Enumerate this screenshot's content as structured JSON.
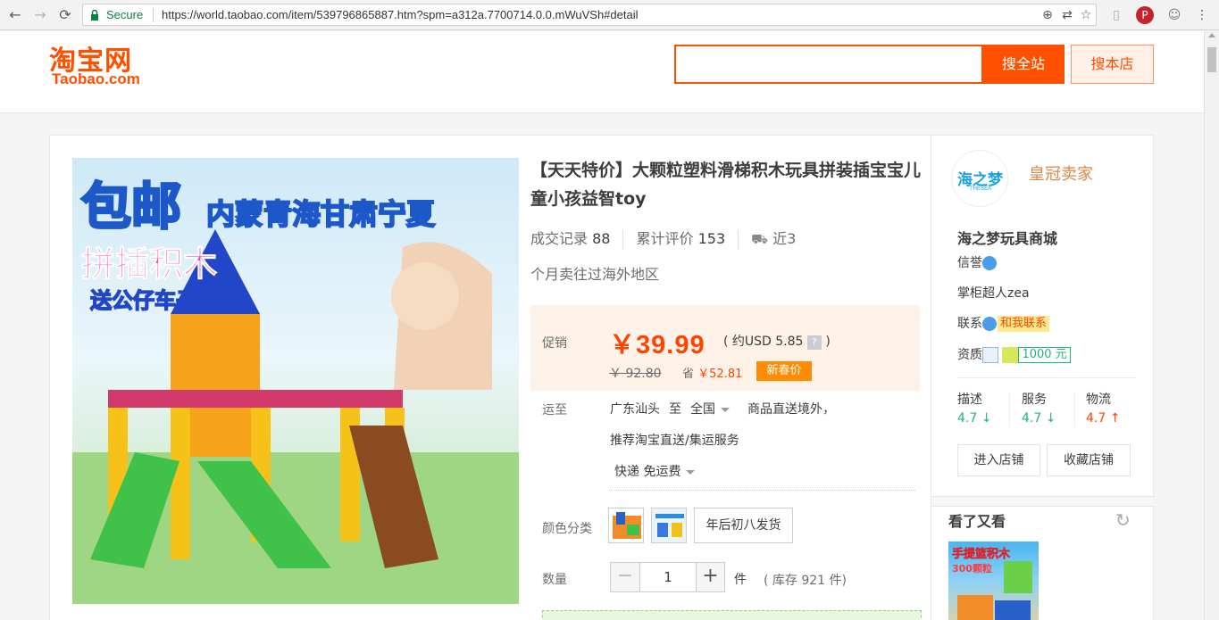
{
  "browser": {
    "secure_label": "Secure",
    "url": "https://world.taobao.com/item/539796865887.htm?spm=a312a.7700714.0.0.mWuVSh#detail"
  },
  "header": {
    "logo_cn": "淘宝网",
    "logo_en": "Taobao.com",
    "search_value": "",
    "search_all_label": "搜全站",
    "search_shop_label": "搜本店"
  },
  "product": {
    "image_text": {
      "free_ship": "包邮",
      "regions": "内蒙青海甘肃宁夏",
      "blocks": "拼插积木",
      "gift": "送公仔车子"
    },
    "title": "【天天特价】大颗粒塑料滑梯积木玩具拼装插宝宝儿童小孩益智toy",
    "sales_label": "成交记录",
    "sales_count": "88",
    "reviews_label": "累计评价",
    "reviews_count": "153",
    "shipping_recent_prefix": "近3",
    "shipping_recent_rest": "个月卖往过海外地区",
    "price": {
      "label": "促销",
      "current": "￥39.99",
      "usd_open": "( 约USD 5.85",
      "usd_close": " )",
      "help_icon": "?",
      "original": "￥ 92.80",
      "save_label": "省",
      "save_amount": "￥52.81",
      "badge": "新春价"
    },
    "shipping": {
      "label": "运至",
      "from": "广东汕头",
      "to_word": "至",
      "destination": "全国",
      "direct": "商品直送境外，",
      "recommend": "推荐淘宝直送/集运服务",
      "method": "快递 免运费"
    },
    "sku": {
      "label": "颜色分类",
      "option_text": "年后初八发货"
    },
    "quantity": {
      "label": "数量",
      "minus": "−",
      "value": "1",
      "plus": "+",
      "unit": "件",
      "stock": "( 库存 921 件)"
    }
  },
  "shop": {
    "logo_text": "海之梦",
    "logo_sub": "THESEA",
    "level": "皇冠卖家",
    "name": "海之梦玩具商城",
    "credit_label": "信誉",
    "owner": "掌柜超人zea",
    "contact_label": "联系",
    "contact_btn": "和我联系",
    "qual_label": "资质",
    "deposit": "1000 元",
    "scores": [
      {
        "name": "描述",
        "value": "4.7",
        "trend": "↓"
      },
      {
        "name": "服务",
        "value": "4.7",
        "trend": "↓"
      },
      {
        "name": "物流",
        "value": "4.7",
        "trend": "↑"
      }
    ],
    "enter_btn": "进入店铺",
    "fav_btn": "收藏店铺",
    "see_also": "看了又看",
    "rec_text": "手提篮积木",
    "rec_text2": "300颗粒"
  },
  "colors": {
    "brand": "#ff5000",
    "price": "#ff4400",
    "score_down": "#21b57a",
    "score_up": "#ff4400"
  }
}
